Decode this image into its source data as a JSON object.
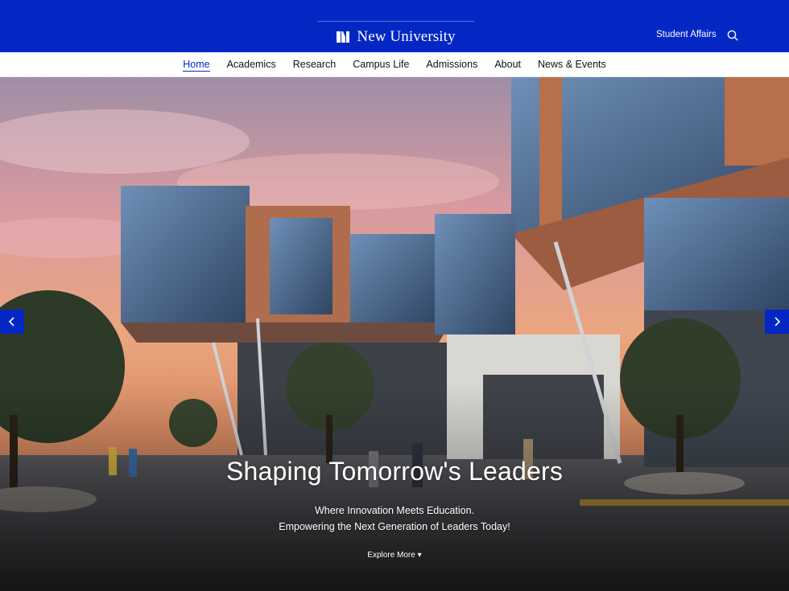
{
  "brand": {
    "name": "New University"
  },
  "header": {
    "student_affairs": "Student Affairs"
  },
  "nav": {
    "items": [
      {
        "label": "Home",
        "active": true
      },
      {
        "label": "Academics"
      },
      {
        "label": "Research"
      },
      {
        "label": "Campus Life"
      },
      {
        "label": "Admissions"
      },
      {
        "label": "About"
      },
      {
        "label": "News & Events"
      }
    ]
  },
  "hero": {
    "title": "Shaping Tomorrow's Leaders",
    "subtitle_line1": "Where Innovation Meets Education.",
    "subtitle_line2": "Empowering the Next Generation of Leaders Today!",
    "cta": "Explore More ▾"
  },
  "icons": {
    "logo": "book-logo-icon",
    "search": "search-icon",
    "prev": "chevron-left-icon",
    "next": "chevron-right-icon"
  },
  "colors": {
    "brand_blue": "#0427c4",
    "text_dark": "#111111",
    "white": "#ffffff"
  }
}
